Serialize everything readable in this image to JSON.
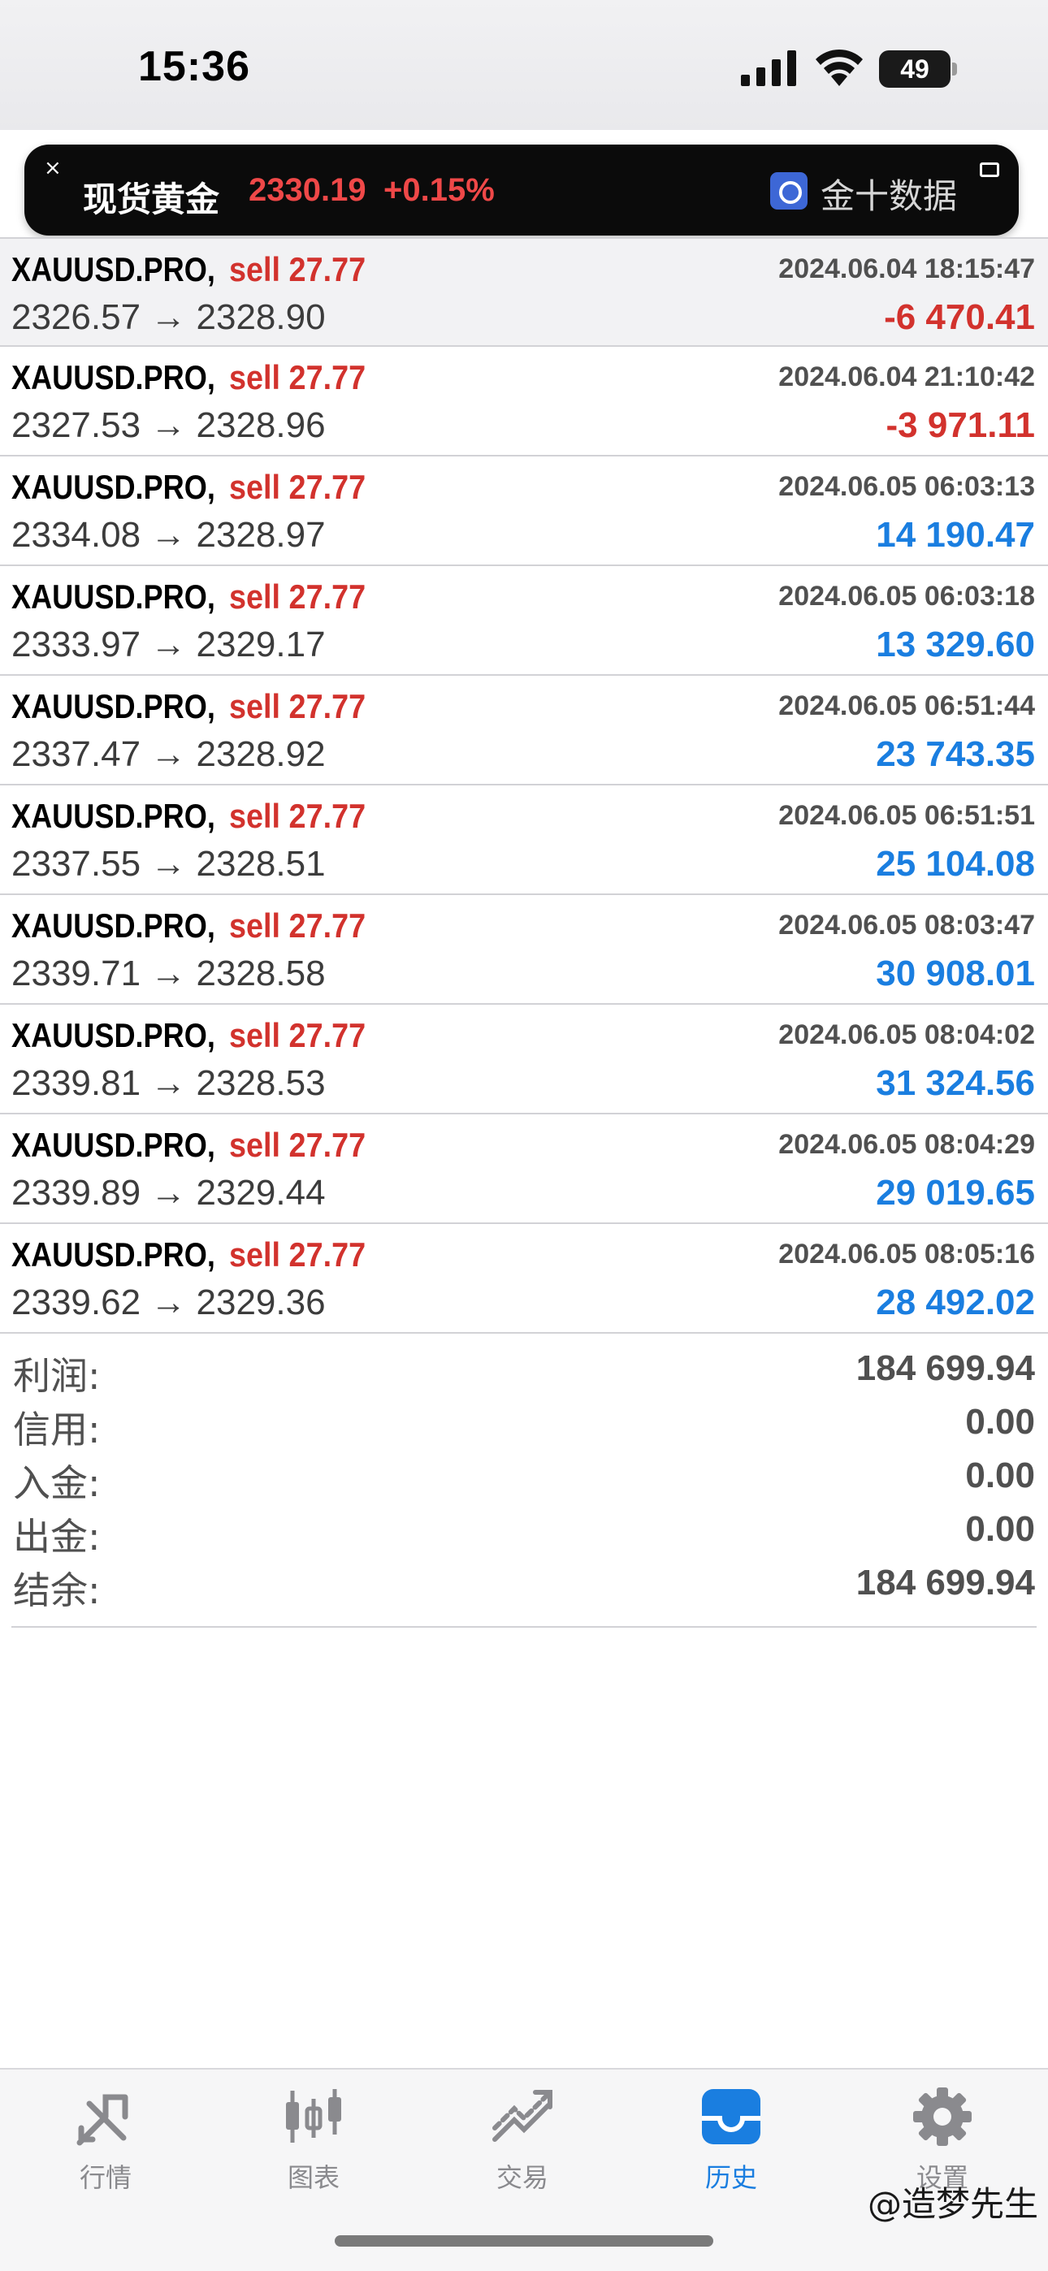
{
  "status_bar": {
    "time": "15:36",
    "battery": "49"
  },
  "ticker": {
    "close": "×",
    "name": "现货黄金",
    "price": "2330.19",
    "change": "+0.15%",
    "source": "金十数据"
  },
  "trades": [
    {
      "symbol": "XAUUSD.PRO,",
      "side": "sell 27.77",
      "prices": "2326.57 → 2328.90",
      "time": "2024.06.04 18:15:47",
      "profit": "-6 470.41",
      "profit_sign": "neg"
    },
    {
      "symbol": "XAUUSD.PRO,",
      "side": "sell 27.77",
      "prices": "2327.53 → 2328.96",
      "time": "2024.06.04 21:10:42",
      "profit": "-3 971.11",
      "profit_sign": "neg"
    },
    {
      "symbol": "XAUUSD.PRO,",
      "side": "sell 27.77",
      "prices": "2334.08 → 2328.97",
      "time": "2024.06.05 06:03:13",
      "profit": "14 190.47",
      "profit_sign": "pos"
    },
    {
      "symbol": "XAUUSD.PRO,",
      "side": "sell 27.77",
      "prices": "2333.97 → 2329.17",
      "time": "2024.06.05 06:03:18",
      "profit": "13 329.60",
      "profit_sign": "pos"
    },
    {
      "symbol": "XAUUSD.PRO,",
      "side": "sell 27.77",
      "prices": "2337.47 → 2328.92",
      "time": "2024.06.05 06:51:44",
      "profit": "23 743.35",
      "profit_sign": "pos"
    },
    {
      "symbol": "XAUUSD.PRO,",
      "side": "sell 27.77",
      "prices": "2337.55 → 2328.51",
      "time": "2024.06.05 06:51:51",
      "profit": "25 104.08",
      "profit_sign": "pos"
    },
    {
      "symbol": "XAUUSD.PRO,",
      "side": "sell 27.77",
      "prices": "2339.71 → 2328.58",
      "time": "2024.06.05 08:03:47",
      "profit": "30 908.01",
      "profit_sign": "pos"
    },
    {
      "symbol": "XAUUSD.PRO,",
      "side": "sell 27.77",
      "prices": "2339.81 → 2328.53",
      "time": "2024.06.05 08:04:02",
      "profit": "31 324.56",
      "profit_sign": "pos"
    },
    {
      "symbol": "XAUUSD.PRO,",
      "side": "sell 27.77",
      "prices": "2339.89 → 2329.44",
      "time": "2024.06.05 08:04:29",
      "profit": "29 019.65",
      "profit_sign": "pos"
    },
    {
      "symbol": "XAUUSD.PRO,",
      "side": "sell 27.77",
      "prices": "2339.62 → 2329.36",
      "time": "2024.06.05 08:05:16",
      "profit": "28 492.02",
      "profit_sign": "pos"
    }
  ],
  "summary": [
    {
      "label": "利润:",
      "value": "184 699.94"
    },
    {
      "label": "信用:",
      "value": "0.00"
    },
    {
      "label": "入金:",
      "value": "0.00"
    },
    {
      "label": "出金:",
      "value": "0.00"
    },
    {
      "label": "结余:",
      "value": "184 699.94"
    }
  ],
  "tabs": [
    {
      "label": "行情",
      "icon": "quotes-icon",
      "active": false
    },
    {
      "label": "图表",
      "icon": "chart-candles-icon",
      "active": false
    },
    {
      "label": "交易",
      "icon": "trade-icon",
      "active": false
    },
    {
      "label": "历史",
      "icon": "history-tray-icon",
      "active": true
    },
    {
      "label": "设置",
      "icon": "gear-icon",
      "active": false
    }
  ],
  "watermark": "@造梦先生",
  "colors": {
    "sell": "#d2322d",
    "loss": "#d2322d",
    "profit": "#1a7ee0",
    "active_tab": "#1a7ee0",
    "inactive_tab": "#8a8a8e"
  }
}
